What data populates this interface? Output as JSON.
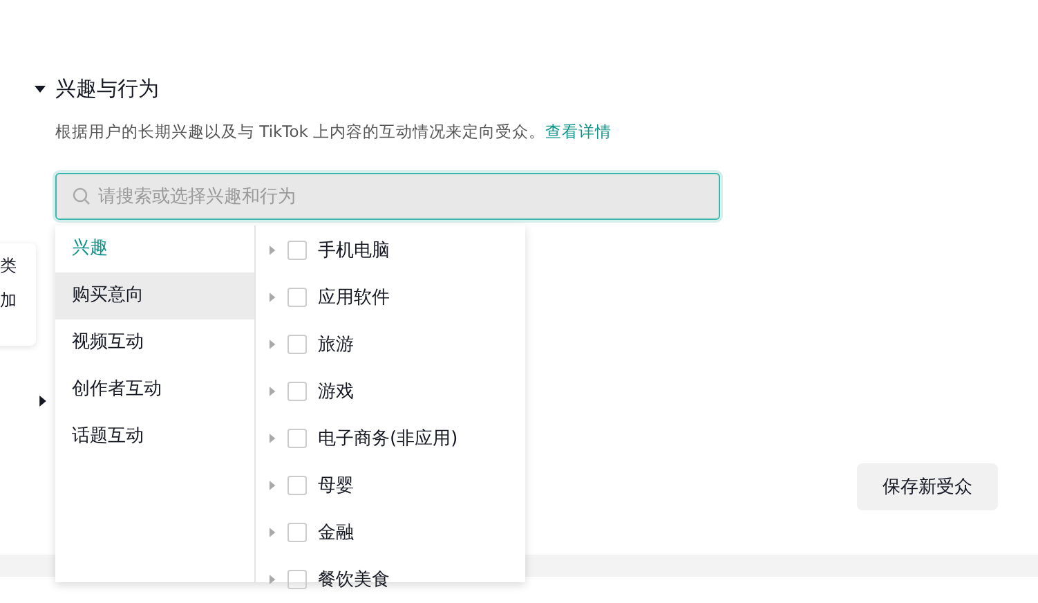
{
  "section": {
    "title": "兴趣与行为",
    "expanded": true,
    "description": "根据用户的长期兴趣以及与 TikTok 上内容的互动情况来定向受众。",
    "link": "查看详情"
  },
  "search": {
    "placeholder": "请搜索或选择兴趣和行为"
  },
  "categories": [
    {
      "label": "兴趣",
      "selected": true
    },
    {
      "label": "购买意向",
      "selected": false
    },
    {
      "label": "视频互动",
      "selected": false
    },
    {
      "label": "创作者互动",
      "selected": false
    },
    {
      "label": "话题互动",
      "selected": false
    }
  ],
  "options": [
    {
      "label": "手机电脑",
      "checked": false
    },
    {
      "label": "应用软件",
      "checked": false
    },
    {
      "label": "旅游",
      "checked": false
    },
    {
      "label": "游戏",
      "checked": false
    },
    {
      "label": "电子商务(非应用)",
      "checked": false
    },
    {
      "label": "母婴",
      "checked": false
    },
    {
      "label": "金融",
      "checked": false
    },
    {
      "label": "餐饮美食",
      "checked": false
    }
  ],
  "side_card": {
    "lines": [
      "类",
      "加"
    ]
  },
  "next_section": {
    "expanded": false
  },
  "save_button": "保存新受众"
}
